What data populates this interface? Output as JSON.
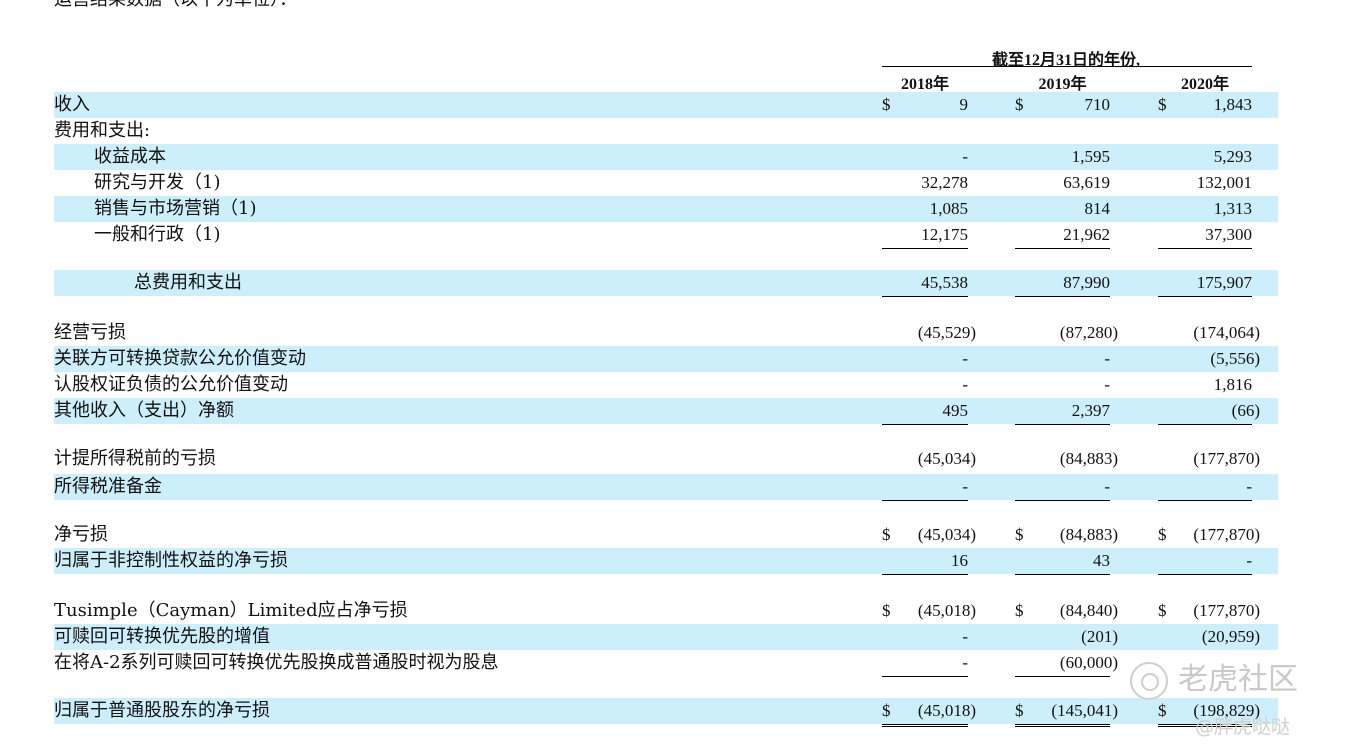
{
  "intro": "运营结果数据（以千为单位）：",
  "header": {
    "title": "截至12月31日的年份,",
    "years": [
      "2018年",
      "2019年",
      "2020年"
    ]
  },
  "rows": [
    {
      "label": "收入",
      "indent": 0,
      "shade": true,
      "dollar": true,
      "values": [
        "9",
        "710",
        "1,843"
      ]
    },
    {
      "label": "费用和支出:",
      "indent": 0,
      "shade": false,
      "values": [
        "",
        "",
        ""
      ]
    },
    {
      "label": "收益成本",
      "indent": 1,
      "shade": true,
      "values": [
        "-",
        "1,595",
        "5,293"
      ]
    },
    {
      "label": "研究与开发（1)",
      "indent": 1,
      "shade": false,
      "values": [
        "32,278",
        "63,619",
        "132,001"
      ]
    },
    {
      "label": "销售与市场营销（1)",
      "indent": 1,
      "shade": true,
      "values": [
        "1,085",
        "814",
        "1,313"
      ]
    },
    {
      "label": "一般和行政（1)",
      "indent": 1,
      "shade": false,
      "underline": true,
      "values": [
        "12,175",
        "21,962",
        "37,300"
      ]
    },
    {
      "label": "总费用和支出",
      "indent": 2,
      "shade": true,
      "underline": true,
      "values": [
        "45,538",
        "87,990",
        "175,907"
      ]
    },
    {
      "label": "经营亏损",
      "indent": 0,
      "shade": false,
      "values": [
        "(45,529)",
        "(87,280)",
        "(174,064)"
      ]
    },
    {
      "label": "关联方可转换贷款公允价值变动",
      "indent": 0,
      "shade": true,
      "values": [
        "-",
        "-",
        "(5,556)"
      ]
    },
    {
      "label": "认股权证负债的公允价值变动",
      "indent": 0,
      "shade": false,
      "values": [
        "-",
        "-",
        "1,816"
      ]
    },
    {
      "label": "其他收入（支出）净额",
      "indent": 0,
      "shade": true,
      "underline": true,
      "values": [
        "495",
        "2,397",
        "(66)"
      ]
    },
    {
      "label": "计提所得税前的亏损",
      "indent": 0,
      "shade": false,
      "values": [
        "(45,034)",
        "(84,883)",
        "(177,870)"
      ]
    },
    {
      "label": "所得税准备金",
      "indent": 0,
      "shade": true,
      "underline": true,
      "values": [
        "-",
        "-",
        "-"
      ]
    },
    {
      "label": "净亏损",
      "indent": 0,
      "shade": false,
      "dollar": true,
      "values": [
        "(45,034)",
        "(84,883)",
        "(177,870)"
      ]
    },
    {
      "label": "归属于非控制性权益的净亏损",
      "indent": 0,
      "shade": true,
      "underline": true,
      "values": [
        "16",
        "43",
        "-"
      ]
    },
    {
      "label": "Tusimple（Cayman）Limited应占净亏损",
      "indent": 0,
      "shade": false,
      "dollar": true,
      "values": [
        "(45,018)",
        "(84,840)",
        "(177,870)"
      ]
    },
    {
      "label": "可赎回可转换优先股的增值",
      "indent": 0,
      "shade": true,
      "values": [
        "-",
        "(201)",
        "(20,959)"
      ]
    },
    {
      "label": "在将A-2系列可赎回可转换优先股换成普通股时视为股息",
      "indent": 0,
      "shade": false,
      "underline": true,
      "values": [
        "-",
        "(60,000)",
        ""
      ]
    },
    {
      "label": "归属于普通股股东的净亏损",
      "indent": 0,
      "shade": true,
      "dollar": true,
      "double": true,
      "values": [
        "(45,018)",
        "(145,041)",
        "(198,829)"
      ]
    }
  ],
  "dollar_sign": "$",
  "watermark": {
    "brand": "老虎社区",
    "handle": "@胖虎哒哒"
  },
  "colors": {
    "row_shade": "#cdeefb"
  }
}
